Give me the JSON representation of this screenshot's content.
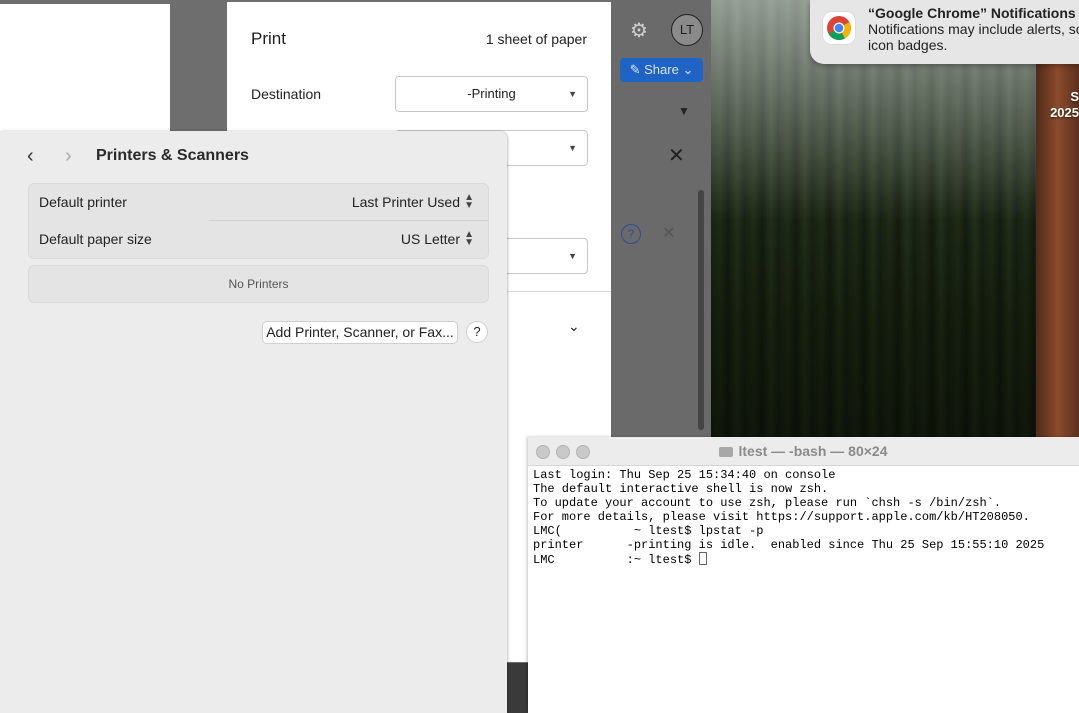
{
  "notification": {
    "title": "“Google Chrome” Notifications",
    "body_line1": "Notifications may include alerts, so",
    "body_line2": "icon badges.",
    "icon": "chrome-icon"
  },
  "desktop": {
    "date_line1": "S",
    "date_line2": "2025"
  },
  "chrome": {
    "avatar_initials": "LT",
    "share_label": "Share",
    "icons": [
      "gear-icon",
      "pencil-icon",
      "chevron-down-icon",
      "close-icon",
      "help-icon"
    ]
  },
  "print_dialog": {
    "title": "Print",
    "sheets": "1 sheet of paper",
    "destination_label": "Destination",
    "destination_value": "-Printing"
  },
  "printers_scanners": {
    "title": "Printers & Scanners",
    "rows": [
      {
        "label": "Default printer",
        "value": "Last Printer Used"
      },
      {
        "label": "Default paper size",
        "value": "US Letter"
      }
    ],
    "no_printers": "No Printers",
    "add_button": "Add Printer, Scanner, or Fax...",
    "help_button": "?"
  },
  "terminal": {
    "title": "ltest — -bash — 80×24",
    "lines": [
      "Last login: Thu Sep 25 15:34:40 on console",
      "",
      "The default interactive shell is now zsh.",
      "To update your account to use zsh, please run `chsh -s /bin/zsh`.",
      "For more details, please visit https://support.apple.com/kb/HT208050.",
      "LMC(          ~ ltest$ lpstat -p",
      "printer      -printing is idle.  enabled since Thu 25 Sep 15:55:10 2025",
      "LMC          :~ ltest$ "
    ]
  }
}
